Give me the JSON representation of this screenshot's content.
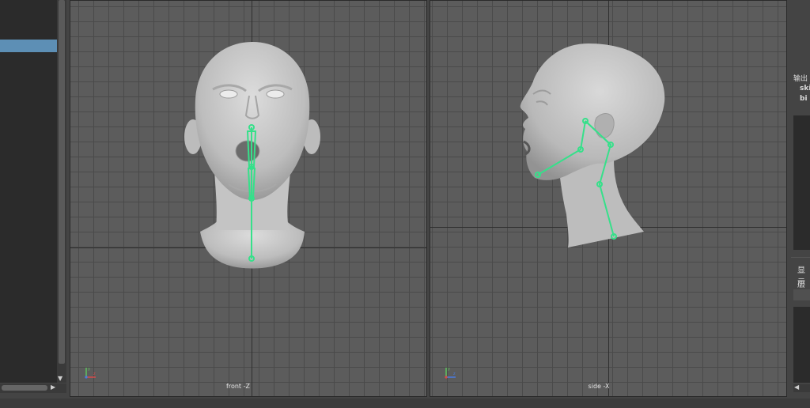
{
  "viewports": {
    "front": {
      "camera_label": "front -Z"
    },
    "side": {
      "camera_label": "side -X"
    }
  },
  "channel_box": {
    "outputs_label": "输出",
    "output_connections": [
      "ski",
      "bi"
    ]
  },
  "layer_editor": {
    "tabs": [
      "显示",
      "层"
    ]
  },
  "colors": {
    "viewport_bg": "#5c5c5c",
    "grid_line": "#4a4a4a",
    "skin_mesh": "#c9c9c9",
    "joint_highlight": "#36e08a",
    "selected_row": "#5d8fb5",
    "panel_bg": "#444444",
    "list_bg": "#2b2b2b"
  },
  "icons": {
    "scroll_down": "triangle-down-icon",
    "scroll_right": "triangle-right-icon",
    "scroll_left": "triangle-left-icon",
    "view_axes": "xyz-axes-icon"
  }
}
